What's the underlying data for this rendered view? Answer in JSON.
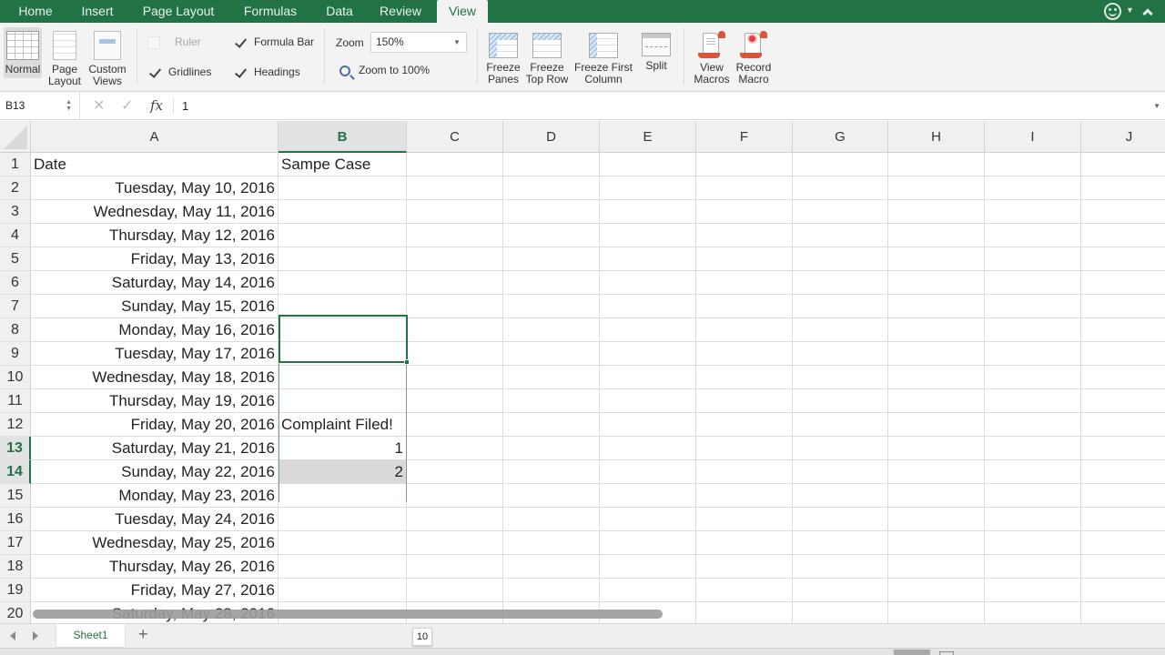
{
  "ribbon": {
    "tabs": [
      {
        "label": "Home"
      },
      {
        "label": "Insert"
      },
      {
        "label": "Page Layout"
      },
      {
        "label": "Formulas"
      },
      {
        "label": "Data"
      },
      {
        "label": "Review"
      },
      {
        "label": "View",
        "active": true
      }
    ],
    "views": {
      "normal": "Normal",
      "page_layout_1": "Page",
      "page_layout_2": "Layout",
      "custom_views_1": "Custom",
      "custom_views_2": "Views"
    },
    "show": {
      "ruler": {
        "label": "Ruler",
        "checked": false,
        "disabled": true
      },
      "formula_bar": {
        "label": "Formula Bar",
        "checked": true
      },
      "gridlines": {
        "label": "Gridlines",
        "checked": true
      },
      "headings": {
        "label": "Headings",
        "checked": true
      }
    },
    "zoom": {
      "label": "Zoom",
      "value": "150%",
      "zoom_to_100": "Zoom to 100%"
    },
    "window": {
      "freeze_panes_1": "Freeze",
      "freeze_panes_2": "Panes",
      "freeze_top_row_1": "Freeze",
      "freeze_top_row_2": "Top Row",
      "freeze_first_col_1": "Freeze First",
      "freeze_first_col_2": "Column",
      "split": "Split"
    },
    "macros": {
      "view_1": "View",
      "view_2": "Macros",
      "record_1": "Record",
      "record_2": "Macro"
    }
  },
  "formula_bar": {
    "name_box": "B13",
    "cancel_icon": "✕",
    "enter_icon": "✓",
    "fx_label": "fx",
    "content": "1"
  },
  "grid": {
    "columns": [
      "A",
      "B",
      "C",
      "D",
      "E",
      "F",
      "G",
      "H",
      "I",
      "J"
    ],
    "selected_column": "B",
    "selected_rows": [
      13,
      14
    ],
    "rows": [
      {
        "num": "1",
        "A": "Date",
        "B": "Sampe Case"
      },
      {
        "num": "2",
        "A": "Tuesday, May 10, 2016",
        "B": ""
      },
      {
        "num": "3",
        "A": "Wednesday, May 11, 2016",
        "B": ""
      },
      {
        "num": "4",
        "A": "Thursday, May 12, 2016",
        "B": ""
      },
      {
        "num": "5",
        "A": "Friday, May 13, 2016",
        "B": ""
      },
      {
        "num": "6",
        "A": "Saturday, May 14, 2016",
        "B": ""
      },
      {
        "num": "7",
        "A": "Sunday, May 15, 2016",
        "B": ""
      },
      {
        "num": "8",
        "A": "Monday, May 16, 2016",
        "B": ""
      },
      {
        "num": "9",
        "A": "Tuesday, May 17, 2016",
        "B": ""
      },
      {
        "num": "10",
        "A": "Wednesday, May 18, 2016",
        "B": ""
      },
      {
        "num": "11",
        "A": "Thursday, May 19, 2016",
        "B": ""
      },
      {
        "num": "12",
        "A": "Friday, May 20, 2016",
        "B": "Complaint Filed!"
      },
      {
        "num": "13",
        "A": "Saturday, May 21, 2016",
        "B": "1"
      },
      {
        "num": "14",
        "A": "Sunday, May 22, 2016",
        "B": "2"
      },
      {
        "num": "15",
        "A": "Monday, May 23, 2016",
        "B": ""
      },
      {
        "num": "16",
        "A": "Tuesday, May 24, 2016",
        "B": ""
      },
      {
        "num": "17",
        "A": "Wednesday, May 25, 2016",
        "B": ""
      },
      {
        "num": "18",
        "A": "Thursday, May 26, 2016",
        "B": ""
      },
      {
        "num": "19",
        "A": "Friday, May 27, 2016",
        "B": ""
      },
      {
        "num": "20",
        "A": "Saturday, May 28, 2016",
        "B": ""
      }
    ]
  },
  "fill_tooltip": "10",
  "sheets": {
    "tabs": [
      {
        "label": "Sheet1",
        "active": true
      }
    ],
    "add_label": "+"
  },
  "colors": {
    "accent": "#217346",
    "selection_fill": "#d9d9d9"
  }
}
